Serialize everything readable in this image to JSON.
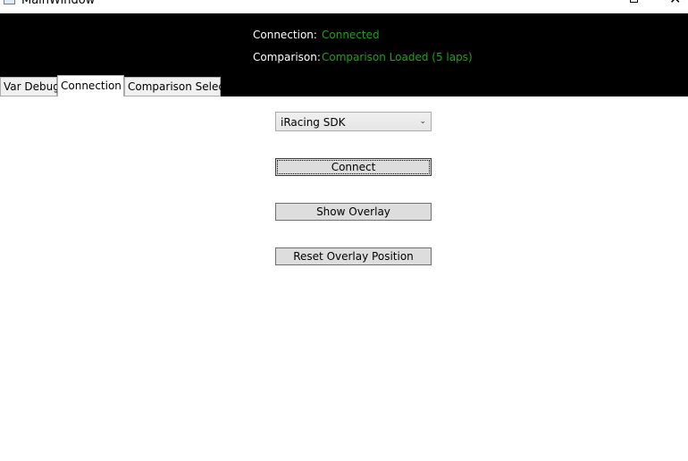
{
  "window": {
    "title": "MainWindow",
    "close_glyph": "✕"
  },
  "status": {
    "connection_label": "Connection:",
    "connection_value": "Connected",
    "comparison_label": "Comparison:",
    "comparison_value": "Comparison Loaded (5 laps)",
    "value_color": "#1aa31a"
  },
  "tabs": [
    {
      "label": "Var Debug",
      "selected": false
    },
    {
      "label": "Connection",
      "selected": true
    },
    {
      "label": "Comparison Select",
      "selected": false
    }
  ],
  "connection_tab": {
    "source_select": {
      "selected": "iRacing SDK",
      "icon": "chevron-down-icon"
    },
    "connect_label": "Connect",
    "show_overlay_label": "Show Overlay",
    "reset_overlay_label": "Reset Overlay Position"
  }
}
